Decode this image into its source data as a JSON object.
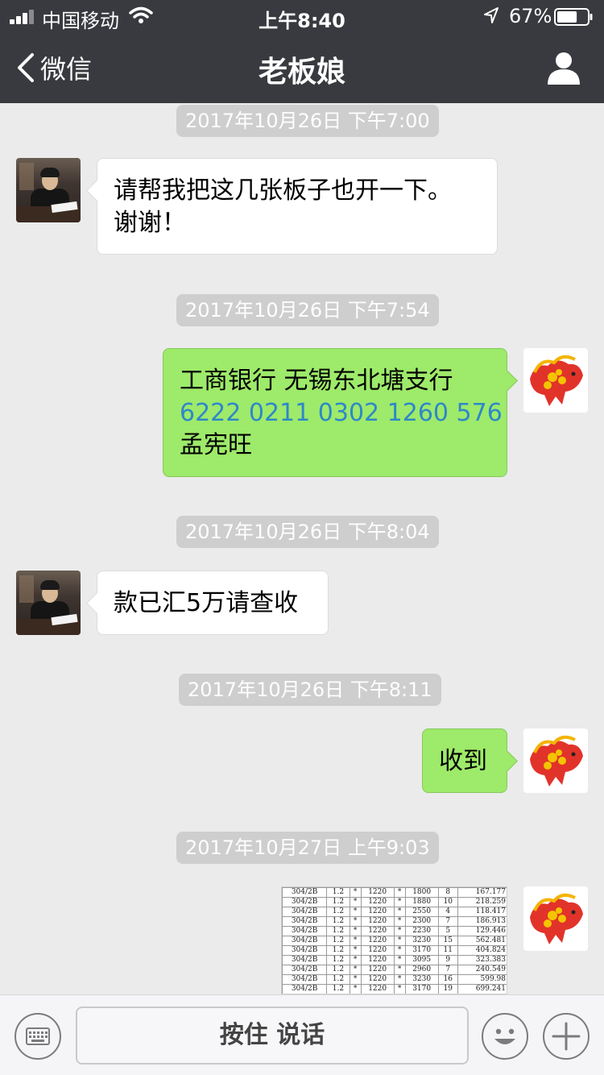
{
  "status_bar": {
    "carrier": "中国移动",
    "time": "上午8:40",
    "battery_percent": "67%",
    "battery_level": 0.67
  },
  "nav": {
    "back_label": "微信",
    "title": "老板娘"
  },
  "messages": [
    {
      "type": "timestamp",
      "text": "2017年10月26日 下午7:00"
    },
    {
      "type": "text",
      "side": "left",
      "lines": [
        "请帮我把这几张板子也开一下。",
        "谢谢！"
      ]
    },
    {
      "type": "timestamp",
      "text": "2017年10月26日 下午7:54"
    },
    {
      "type": "text",
      "side": "right",
      "bank": "工商银行  无锡东北塘支行",
      "account": "6222 0211 0302 1260 576",
      "name": "孟宪旺"
    },
    {
      "type": "timestamp",
      "text": "2017年10月26日 下午8:04"
    },
    {
      "type": "text",
      "side": "left",
      "text": "款已汇5万请查收"
    },
    {
      "type": "timestamp",
      "text": "2017年10月26日 下午8:11"
    },
    {
      "type": "text",
      "side": "right",
      "text": "收到"
    },
    {
      "type": "timestamp",
      "text": "2017年10月27日 上午9:03"
    },
    {
      "type": "image",
      "side": "right",
      "table_rows": [
        [
          "304/2B",
          "1.2",
          "*",
          "1220",
          "*",
          "1800",
          "8",
          "167.177"
        ],
        [
          "304/2B",
          "1.2",
          "*",
          "1220",
          "*",
          "1880",
          "10",
          "218.259"
        ],
        [
          "304/2B",
          "1.2",
          "*",
          "1220",
          "*",
          "2550",
          "4",
          "118.417"
        ],
        [
          "304/2B",
          "1.2",
          "*",
          "1220",
          "*",
          "2300",
          "7",
          "186.913"
        ],
        [
          "304/2B",
          "1.2",
          "*",
          "1220",
          "*",
          "2230",
          "5",
          "129.446"
        ],
        [
          "304/2B",
          "1.2",
          "*",
          "1220",
          "*",
          "3230",
          "15",
          "562.481"
        ],
        [
          "304/2B",
          "1.2",
          "*",
          "1220",
          "*",
          "3170",
          "11",
          "404.824"
        ],
        [
          "304/2B",
          "1.2",
          "*",
          "1220",
          "*",
          "3095",
          "9",
          "323.383"
        ],
        [
          "304/2B",
          "1.2",
          "*",
          "1220",
          "*",
          "2960",
          "7",
          "240.549"
        ],
        [
          "304/2B",
          "1.2",
          "*",
          "1220",
          "*",
          "3230",
          "16",
          "599.98"
        ],
        [
          "304/2B",
          "1.2",
          "*",
          "1220",
          "*",
          "3170",
          "19",
          "699.241"
        ]
      ]
    }
  ],
  "input_bar": {
    "hold_to_talk": "按住 说话"
  },
  "icons": {
    "signal": "signal-bars-icon",
    "wifi": "wifi-icon",
    "location": "location-arrow-icon",
    "battery": "battery-icon",
    "back": "chevron-left-icon",
    "profile": "person-icon",
    "keyboard": "keyboard-icon",
    "emoji": "smiley-icon",
    "more": "plus-icon"
  },
  "colors": {
    "nav_bg": "#393a3f",
    "chat_bg": "#ebebeb",
    "sent_bubble": "#9eea6a",
    "received_bubble": "#ffffff",
    "link": "#2e88c8",
    "timestamp_bg": "#cecece"
  }
}
